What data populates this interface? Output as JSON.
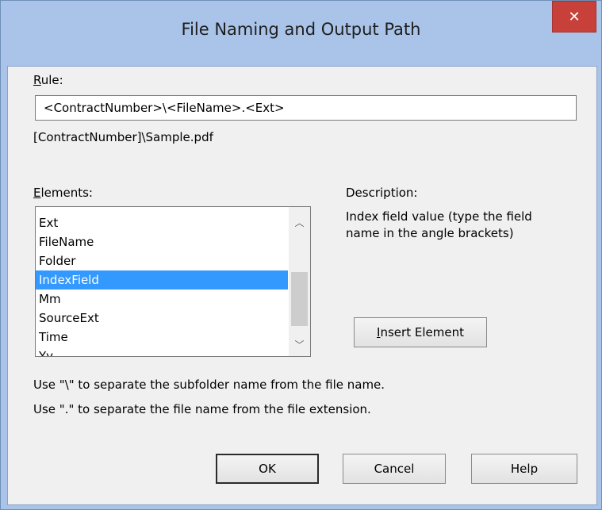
{
  "window": {
    "title": "File Naming and Output Path",
    "close_symbol": "✕"
  },
  "rule": {
    "label": "Rule:",
    "value": "<ContractNumber>\\<FileName>.<Ext>",
    "preview": "[ContractNumber]\\Sample.pdf"
  },
  "elements": {
    "label": "Elements:",
    "items": [
      {
        "label": "Ext"
      },
      {
        "label": "FileName"
      },
      {
        "label": "Folder"
      },
      {
        "label": "IndexField"
      },
      {
        "label": "Mm"
      },
      {
        "label": "SourceExt"
      },
      {
        "label": "Time"
      },
      {
        "label": "Yy"
      }
    ],
    "selected": "IndexField",
    "scroll_up_icon": "chevron-up-icon",
    "scroll_down_icon": "chevron-down-icon"
  },
  "description": {
    "label": "Description:",
    "text": "Index field value (type the field name in the angle brackets)"
  },
  "insert_button": "Insert Element",
  "hints": {
    "line1": "Use \"\\\" to separate the subfolder name from the file name.",
    "line2": "Use \".\" to separate the file name from the file extension."
  },
  "buttons": {
    "ok": "OK",
    "cancel": "Cancel",
    "help": "Help"
  },
  "colors": {
    "frame": "#a9c4e8",
    "close": "#c7403a",
    "selection": "#3399ff",
    "dialog_bg": "#f0f0f0"
  }
}
